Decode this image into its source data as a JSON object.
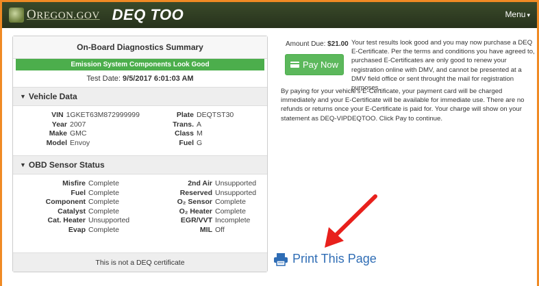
{
  "header": {
    "logo_text_prefix": "O",
    "logo_text_rest": "REGON.GOV",
    "app_title": "DEQ TOO",
    "menu_label": "Menu"
  },
  "summary": {
    "title": "On-Board Diagnostics Summary",
    "status": "Emission System Components Look Good",
    "status_color": "#4cae4c",
    "test_date_label": "Test Date:",
    "test_date_value": "9/5/2017 6:01:03 AM"
  },
  "vehicle": {
    "section_title": "Vehicle Data",
    "left": [
      {
        "k": "VIN",
        "v": "1GKET63M872999999"
      },
      {
        "k": "Year",
        "v": "2007"
      },
      {
        "k": "Make",
        "v": "GMC"
      },
      {
        "k": "Model",
        "v": "Envoy"
      }
    ],
    "right": [
      {
        "k": "Plate",
        "v": "DEQTST30"
      },
      {
        "k": "Trans.",
        "v": "A"
      },
      {
        "k": "Class",
        "v": "M"
      },
      {
        "k": "Fuel",
        "v": "G"
      }
    ]
  },
  "obd": {
    "section_title": "OBD Sensor Status",
    "left": [
      {
        "k": "Misfire",
        "v": "Complete"
      },
      {
        "k": "Fuel",
        "v": "Complete"
      },
      {
        "k": "Component",
        "v": "Complete"
      },
      {
        "k": "Catalyst",
        "v": "Complete"
      },
      {
        "k": "Cat. Heater",
        "v": "Unsupported"
      },
      {
        "k": "Evap",
        "v": "Complete"
      }
    ],
    "right": [
      {
        "k": "2nd Air",
        "v": "Unsupported"
      },
      {
        "k": "Reserved",
        "v": "Unsupported"
      },
      {
        "k": "O₂ Sensor",
        "v": "Complete"
      },
      {
        "k": "O₂ Heater",
        "v": "Complete"
      },
      {
        "k": "EGR/VVT",
        "v": "Incomplete"
      },
      {
        "k": "MIL",
        "v": "Off"
      }
    ]
  },
  "footer_note": "This is not a DEQ certificate",
  "payment": {
    "amount_label": "Amount Due:",
    "amount_value": "$21.00",
    "pay_button": "Pay Now",
    "pay_color": "#5cb85c",
    "intro": "Your test results look good and you may now purchase a DEQ E-Certificate. Per the terms and conditions you have agreed to, purchased E-Certificates are only good to renew your registration online with DMV, and cannot be presented at a DMV field office or sent throught the mail for registration purposes.",
    "terms": "By paying for your vehicle's E-Certificate, your payment card will be charged immediately and your E-Certificate will be available for immediate use. There are no refunds or returns once your E-Certificate is paid for. Your charge will show on your statement as DEQ-VIPDEQTOO. Click Pay to continue."
  },
  "print_label": "Print This Page",
  "icons": [
    "oregon-logo-icon",
    "caret-down-icon",
    "triangle-down-icon",
    "credit-card-icon",
    "printer-icon",
    "red-arrow-annotation"
  ]
}
